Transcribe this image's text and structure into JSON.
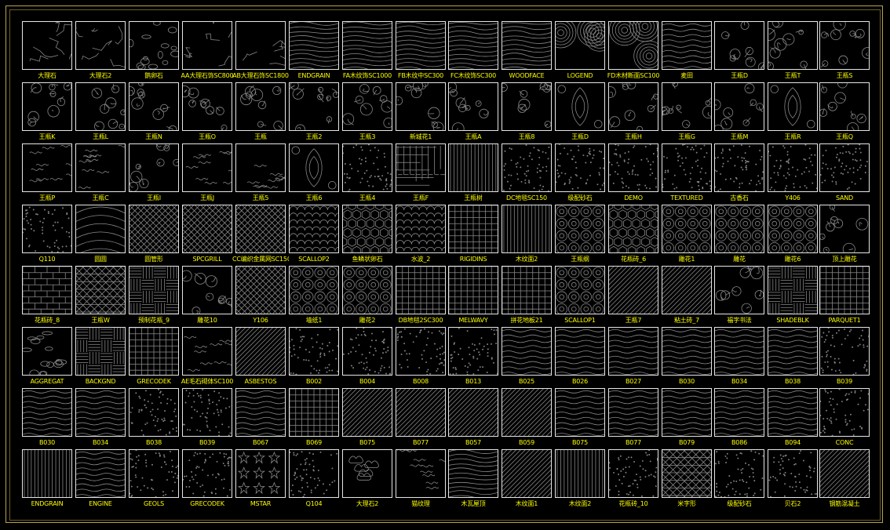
{
  "colors": {
    "background": "#000000",
    "frame": "#b8a24a",
    "tile_border": "#e6e6e6",
    "label": "#ffff00",
    "pattern": "#8a8a8a"
  },
  "rows": [
    [
      "大理石",
      "大理石2",
      "鹅卵石",
      "AA大理石饰SC800",
      "AB大理石饰SC1800",
      "ENDGRAIN",
      "FA木纹饰SC1000",
      "FB木纹中SC300",
      "FC木纹饰SC300",
      "WOODFACE",
      "LOGEND",
      "FD木材断面SC100",
      "麦田",
      "王瓶D",
      "王瓶T",
      "王瓶S"
    ],
    [
      "王瓶K",
      "王瓶L",
      "王瓶N",
      "王瓶O",
      "王瓶",
      "王瓶2",
      "王瓶3",
      "新城花1",
      "王瓶A",
      "王瓶8",
      "王瓶D",
      "王瓶H",
      "王瓶G",
      "王瓶M",
      "王瓶R",
      "王瓶Q"
    ],
    [
      "王瓶P",
      "王瓶C",
      "王瓶I",
      "王瓶J",
      "王瓶5",
      "王瓶6",
      "王瓶4",
      "王瓶F",
      "王瓶树",
      "DC地毯SC150",
      "级配砂石",
      "DEMO",
      "TEXTURED",
      "古香石",
      "Y406",
      "SAND"
    ],
    [
      "Q110",
      "圆圆",
      "圆管形",
      "SPCGRILL",
      "CC编织金属网SC150",
      "SCALLOP2",
      "鱼鳞状卵石",
      "水波_2",
      "RIGIDINS",
      "木纹面2",
      "王瓶纲",
      "花瓶砖_6",
      "雕花1",
      "雕花",
      "雕花6",
      "顶上雕花"
    ],
    [
      "花瓶砖_8",
      "王瓶W",
      "预制花瓶_9",
      "雕花10",
      "Y106",
      "墙纸1",
      "雕花2",
      "DB地毯2SC300",
      "MELWAVY",
      "拼花地板21",
      "SCALLOP1",
      "王瓶7",
      "粘土砖_7",
      "福字书法",
      "SHADEBLK",
      "PARQUET1"
    ],
    [
      "AGGREGAT",
      "BACKGND",
      "GRECODEK",
      "AE毛石砌体SC100",
      "ASBESTOS",
      "B002",
      "B004",
      "B008",
      "B013",
      "B025",
      "B026",
      "B027",
      "B030",
      "B034",
      "B038",
      "B039"
    ],
    [
      "B030",
      "B034",
      "B038",
      "B039",
      "B067",
      "B069",
      "B075",
      "B077",
      "B057",
      "B059",
      "B075",
      "B077",
      "B079",
      "B086",
      "B094",
      "CONC"
    ],
    [
      "ENDGRAIN",
      "ENGINE",
      "GEOLS",
      "GRECODEK",
      "MSTAR",
      "Q104",
      "大理石2",
      "猫纹理",
      "木瓦屋顶",
      "木纹面1",
      "木纹面2",
      "花瓶砖_10",
      "米字形",
      "级配砂石",
      "贝石2",
      "钢筋混凝土"
    ]
  ],
  "patterns": [
    [
      "marble",
      "marble",
      "pebble",
      "marble",
      "marble",
      "wood",
      "wood",
      "wood",
      "wood",
      "wood",
      "ring",
      "ring",
      "wave",
      "floral",
      "floral",
      "floral"
    ],
    [
      "floral",
      "floral",
      "floral",
      "floral",
      "floral",
      "floral",
      "floral",
      "floral",
      "floral",
      "floral",
      "damask",
      "floral",
      "floral",
      "floral",
      "damask",
      "floral"
    ],
    [
      "squiggle",
      "squiggle",
      "floral",
      "squiggle",
      "squiggle",
      "damask",
      "dots",
      "maze",
      "vbars",
      "dots",
      "dots",
      "dots",
      "dots",
      "dots",
      "dots",
      "dots"
    ],
    [
      "dots",
      "curve",
      "diamond",
      "diamond",
      "diamond",
      "scallop",
      "hex",
      "scallop",
      "grid",
      "vbars",
      "circle",
      "hex",
      "circle",
      "circle",
      "circle",
      "floral"
    ],
    [
      "brick",
      "cross",
      "basket",
      "floral",
      "diamond",
      "circle",
      "circle",
      "grid",
      "grid",
      "grid",
      "circle",
      "diag",
      "diag",
      "floral",
      "basket",
      "grid"
    ],
    [
      "pebble",
      "basket",
      "grid",
      "squiggle",
      "diag",
      "dots",
      "dots",
      "dots",
      "dots",
      "wave",
      "wave",
      "wave",
      "wave",
      "wave",
      "wave",
      "dots"
    ],
    [
      "wave",
      "wave",
      "dots",
      "dots",
      "wave",
      "grid",
      "diag",
      "diag",
      "diag",
      "diag",
      "wave",
      "wave",
      "wave",
      "wave",
      "wave",
      "dots"
    ],
    [
      "vbars",
      "wave",
      "dots",
      "dots",
      "star",
      "dots",
      "cloud",
      "squiggle",
      "wood",
      "diag",
      "vbars",
      "dots",
      "cross",
      "dots",
      "dots",
      "diag"
    ]
  ]
}
